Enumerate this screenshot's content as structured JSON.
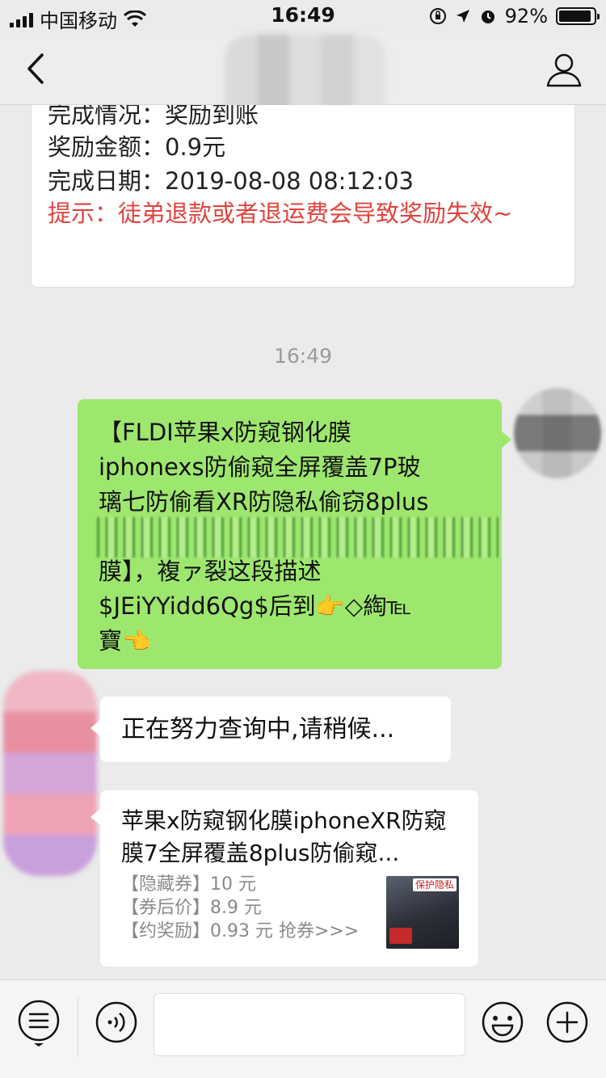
{
  "status_bar": {
    "carrier": "中国移动",
    "time": "16:49",
    "battery_percent": "92%",
    "battery_level": 0.92
  },
  "nav": {
    "back_icon": "chevron-left-icon",
    "profile_icon": "person-icon"
  },
  "messages": {
    "reward_card": {
      "line1": "完成情况：奖励到账",
      "line2": "奖励金额：0.9元",
      "line3": "完成日期：2019-08-08 08:12:03",
      "tip": "提示：徒弟退款或者退运费会导致奖励失效~"
    },
    "timestamp": "16:49",
    "sent": {
      "line1": "【FLDI苹果x防窥钢化膜",
      "line2": "iphonexs防偷窥全屏覆盖7P玻",
      "line3": "璃七防偷看XR防隐私偷窃8plus",
      "line4": "膜】，複ァ裂这段描述",
      "line5": "$JEiYYidd6Qg$后到👉◇綯℡",
      "line6": "寶👈"
    },
    "status_reply": "正在努力查询中,请稍候...",
    "product": {
      "title": "苹果x防窥钢化膜iphoneXR防窥膜7全屏覆盖8plus防偷窥...",
      "coupon": "【隐藏券】10 元",
      "final_price": "【券后价】8.9 元",
      "reward": "【约奖励】0.93 元 抢券>>>",
      "thumb_label": "保护隐私"
    }
  },
  "input_bar": {
    "menu_icon": "menu-icon",
    "voice_icon": "voice-icon",
    "emoji_icon": "emoji-icon",
    "plus_icon": "plus-icon",
    "placeholder": ""
  },
  "colors": {
    "sent_bubble": "#9ee76f",
    "tip_text": "#e0433e",
    "background": "#ebebeb"
  }
}
